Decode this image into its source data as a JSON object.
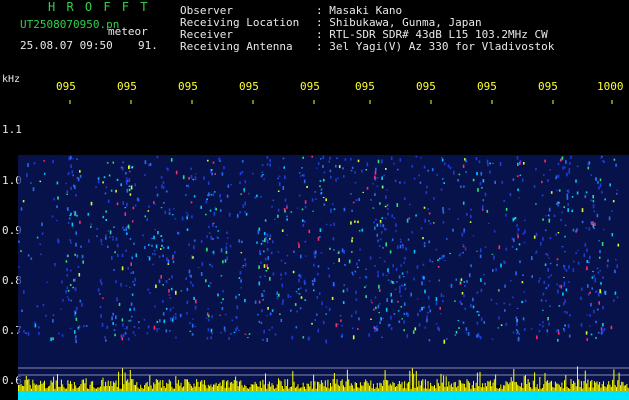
{
  "header": {
    "app_title": "H R O F F T",
    "filename": "UT2508070950.pn",
    "type_label": "meteor",
    "datetime": "25.08.07 09:50",
    "signal_count": "91.",
    "info_labels": [
      "Observer",
      "Receiving Location",
      "Receiver",
      "Receiving Antenna"
    ],
    "info_values": [
      ": Masaki Kano",
      ": Shibukawa, Gunma, Japan",
      ": RTL-SDR SDR# 43dB L15 103.2MHz CW",
      ": 3el Yagi(V) Az 330 for Vladivostok"
    ]
  },
  "axis": {
    "y_unit": "kHz",
    "y_ticks": [
      "1.1",
      "1.0",
      "0.9",
      "0.8",
      "0.7",
      "0.6"
    ],
    "x_ticks": [
      "095",
      "095",
      "095",
      "095",
      "095",
      "095",
      "095",
      "095",
      "095",
      "1000"
    ]
  },
  "colors": {
    "background": "#000000",
    "header_green": "#2fd24a",
    "text_white": "#e8e8e8",
    "time_yellow": "#ffff33",
    "bar_yellow": "#ffff00",
    "base_cyan": "#00e5ff"
  }
}
